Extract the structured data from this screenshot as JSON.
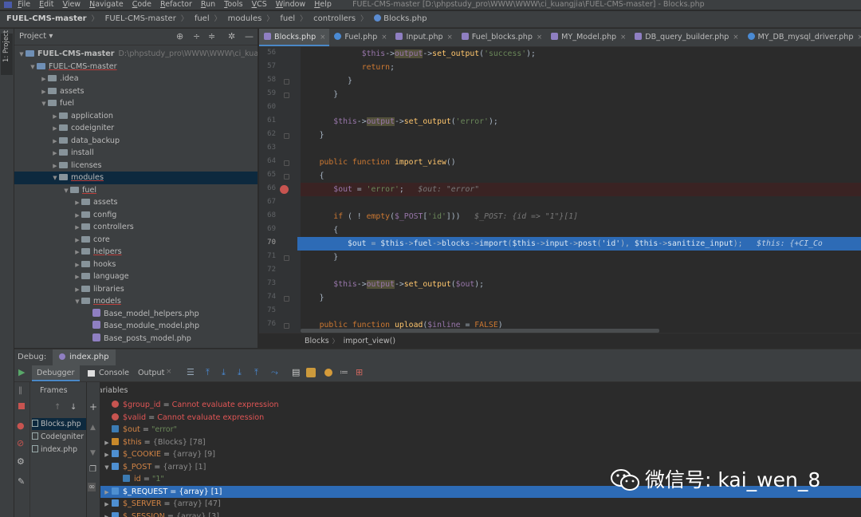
{
  "menu": {
    "items": [
      "File",
      "Edit",
      "View",
      "Navigate",
      "Code",
      "Refactor",
      "Run",
      "Tools",
      "VCS",
      "Window",
      "Help"
    ],
    "window_title": "FUEL-CMS-master [D:\\phpstudy_pro\\WWW\\WWW\\ci_kuangjia\\FUEL-CMS-master] - Blocks.php"
  },
  "breadcrumb": [
    "FUEL-CMS-master",
    "FUEL-CMS-master",
    "fuel",
    "modules",
    "fuel",
    "controllers",
    "Blocks.php"
  ],
  "left_strip": {
    "label": "1: Project"
  },
  "project": {
    "header": "Project ▾",
    "tree": [
      {
        "label": "FUEL-CMS-master",
        "hint": "D:\\phpstudy_pro\\WWW\\WWW\\ci_kuangjia",
        "kind": "mod",
        "depth": 0,
        "open": true
      },
      {
        "label": "FUEL-CMS-master",
        "kind": "mod",
        "depth": 1,
        "open": true
      },
      {
        "label": ".idea",
        "kind": "folder",
        "depth": 2,
        "open": false
      },
      {
        "label": "assets",
        "kind": "folder",
        "depth": 2,
        "open": false
      },
      {
        "label": "fuel",
        "kind": "folder",
        "depth": 2,
        "open": true
      },
      {
        "label": "application",
        "kind": "folder",
        "depth": 3,
        "open": false
      },
      {
        "label": "codeigniter",
        "kind": "folder",
        "depth": 3,
        "open": false
      },
      {
        "label": "data_backup",
        "kind": "folder",
        "depth": 3,
        "open": false
      },
      {
        "label": "install",
        "kind": "folder",
        "depth": 3,
        "open": false
      },
      {
        "label": "licenses",
        "kind": "folder",
        "depth": 3,
        "open": false
      },
      {
        "label": "modules",
        "kind": "folder",
        "depth": 3,
        "open": true,
        "selected": true
      },
      {
        "label": "fuel",
        "kind": "folder",
        "depth": 4,
        "open": true
      },
      {
        "label": "assets",
        "kind": "folder",
        "depth": 5,
        "open": false
      },
      {
        "label": "config",
        "kind": "folder",
        "depth": 5,
        "open": false
      },
      {
        "label": "controllers",
        "kind": "folder",
        "depth": 5,
        "open": false
      },
      {
        "label": "core",
        "kind": "folder",
        "depth": 5,
        "open": false
      },
      {
        "label": "helpers",
        "kind": "folder",
        "depth": 5,
        "open": false
      },
      {
        "label": "hooks",
        "kind": "folder",
        "depth": 5,
        "open": false
      },
      {
        "label": "language",
        "kind": "folder",
        "depth": 5,
        "open": false
      },
      {
        "label": "libraries",
        "kind": "folder",
        "depth": 5,
        "open": false
      },
      {
        "label": "models",
        "kind": "folder",
        "depth": 5,
        "open": true
      },
      {
        "label": "Base_model_helpers.php",
        "kind": "file",
        "depth": 6
      },
      {
        "label": "Base_module_model.php",
        "kind": "file",
        "depth": 6
      },
      {
        "label": "Base_posts_model.php",
        "kind": "file",
        "depth": 6
      }
    ]
  },
  "editor": {
    "tabs": [
      {
        "label": "Blocks.php",
        "icon": "php",
        "active": true
      },
      {
        "label": "Fuel.php",
        "icon": "class"
      },
      {
        "label": "Input.php",
        "icon": "php"
      },
      {
        "label": "Fuel_blocks.php",
        "icon": "php"
      },
      {
        "label": "MY_Model.php",
        "icon": "php"
      },
      {
        "label": "DB_query_builder.php",
        "icon": "php"
      },
      {
        "label": "MY_DB_mysql_driver.php",
        "icon": "class"
      }
    ],
    "lines": [
      {
        "n": "56",
        "html": "            <span class='var'>$this</span>-><span class='hl var'>output</span>-><span class='fn'>set_output</span>(<span class='str'>'success'</span>);"
      },
      {
        "n": "57",
        "html": "            <span class='kw'>return</span>;"
      },
      {
        "n": "58",
        "html": "         }"
      },
      {
        "n": "59",
        "html": "      }"
      },
      {
        "n": "60",
        "html": ""
      },
      {
        "n": "61",
        "html": "      <span class='var'>$this</span>-><span class='hl var'>output</span>-><span class='fn'>set_output</span>(<span class='str'>'error'</span>);"
      },
      {
        "n": "62",
        "html": "   }"
      },
      {
        "n": "63",
        "html": ""
      },
      {
        "n": "64",
        "html": "   <span class='kw'>public function</span> <span class='fn'>import_view</span>()"
      },
      {
        "n": "65",
        "html": "   {"
      },
      {
        "n": "66",
        "html": "      <span class='var'>$out</span> = <span class='str'>'error'</span>;   <span class='hint'>$out: \"error\"</span>",
        "state": "bp"
      },
      {
        "n": "67",
        "html": ""
      },
      {
        "n": "68",
        "html": "      <span class='kw'>if</span> ( ! <span class='kw'>empty</span>(<span class='var'>$_POST</span>[<span class='str'>'id'</span>]))   <span class='hint'>$_POST: {id =&gt; \"1\"}[1]</span>"
      },
      {
        "n": "69",
        "html": "      {"
      },
      {
        "n": "70",
        "html": "         <span class='var'>$out</span> = <span class='var'>$this</span>-><span class='var'>fuel</span>-><span class='var'>blocks</span>-><span class='fn'>import</span>(<span class='var'>$this</span>-><span class='var'>input</span>-><span class='fn'>post</span>(<span class='str'>'id'</span>), <span class='var'>$this</span>-><span class='var'>sanitize_input</span>);   <span class='hint'>$this: {+CI_Co</span>",
        "state": "exec"
      },
      {
        "n": "71",
        "html": "      }"
      },
      {
        "n": "72",
        "html": ""
      },
      {
        "n": "73",
        "html": "      <span class='var'>$this</span>-><span class='hl var'>output</span>-><span class='fn'>set_output</span>(<span class='var'>$out</span>);"
      },
      {
        "n": "74",
        "html": "   }"
      },
      {
        "n": "75",
        "html": ""
      },
      {
        "n": "76",
        "html": "   <span class='kw'>public function</span> <span class='fn'>upload</span>(<span class='var'>$inline</span> = <span class='kw'>FALSE</span>)"
      }
    ],
    "breadcrumb": [
      "Blocks",
      "import_view()"
    ]
  },
  "debug": {
    "label": "Debug:",
    "tab": "index.php",
    "tabs": {
      "debugger": "Debugger",
      "console": "Console",
      "output": "Output"
    },
    "frames_header": "Frames",
    "variables_header": "Variables",
    "frames": [
      {
        "label": "Blocks.php",
        "selected": true
      },
      {
        "label": "CodeIgniter",
        "selected": false
      },
      {
        "label": "index.php",
        "selected": false
      }
    ],
    "variables": [
      {
        "arrow": "",
        "icon": "err",
        "name": "$group_id",
        "sep": " = ",
        "value": "Cannot evaluate expression",
        "vclass": "err",
        "nclass": "e",
        "depth": 0
      },
      {
        "arrow": "",
        "icon": "err",
        "name": "$valid",
        "sep": " = ",
        "value": "Cannot evaluate expression",
        "vclass": "err",
        "nclass": "e",
        "depth": 0
      },
      {
        "arrow": "",
        "icon": "val",
        "name": "$out",
        "sep": " = ",
        "value": "\"error\"",
        "vclass": "str",
        "depth": 0
      },
      {
        "arrow": "›",
        "icon": "obj",
        "name": "$this",
        "sep": " = ",
        "value": "{Blocks} [78]",
        "vclass": "type",
        "depth": 0
      },
      {
        "arrow": "›",
        "icon": "arr",
        "name": "$_COOKIE",
        "sep": " = ",
        "value": "{array} [9]",
        "vclass": "type",
        "depth": 0
      },
      {
        "arrow": "⌄",
        "icon": "arr",
        "name": "$_POST",
        "sep": " = ",
        "value": "{array} [1]",
        "vclass": "type",
        "depth": 0
      },
      {
        "arrow": "",
        "icon": "val",
        "name": "id",
        "sep": " = ",
        "value": "\"1\"",
        "vclass": "str",
        "depth": 1
      },
      {
        "arrow": "›",
        "icon": "arr",
        "name": "$_REQUEST",
        "sep": " = ",
        "value": "{array} [1]",
        "vclass": "type",
        "depth": 0,
        "selected": true
      },
      {
        "arrow": "›",
        "icon": "arr",
        "name": "$_SERVER",
        "sep": " = ",
        "value": "{array} [47]",
        "vclass": "type",
        "depth": 0
      },
      {
        "arrow": "›",
        "icon": "arr",
        "name": "$_SESSION",
        "sep": " = ",
        "value": "{array} [3]",
        "vclass": "type",
        "depth": 0
      }
    ]
  },
  "watermark": {
    "text": "微信号: kai_wen_8"
  },
  "colors": {
    "accent": "#4a88c7",
    "selection": "#2d6bb6",
    "breakpoint": "#c75450"
  }
}
